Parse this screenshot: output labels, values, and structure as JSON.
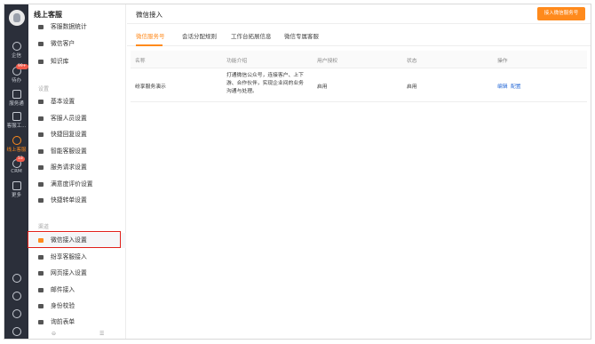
{
  "rail": {
    "items": [
      {
        "label": "企信",
        "icon": "chat-icon"
      },
      {
        "label": "待办",
        "icon": "todo-icon",
        "badge": "99+"
      },
      {
        "label": "服务通",
        "icon": "calendar-icon"
      },
      {
        "label": "客服工...",
        "icon": "box-icon"
      },
      {
        "label": "线上客服",
        "icon": "smile-icon"
      },
      {
        "label": "CRM",
        "icon": "clock-icon",
        "badge": "53"
      },
      {
        "label": "更多",
        "icon": "grid-icon"
      }
    ],
    "bottom_icons": [
      "help-icon",
      "settings-icon",
      "history-icon",
      "user-icon"
    ]
  },
  "sidebar": {
    "title": "线上客服",
    "top_items": [
      {
        "label": "客服数据统计"
      },
      {
        "label": "微信客户"
      },
      {
        "label": "知识库"
      }
    ],
    "settings_group": "设置",
    "settings_items": [
      {
        "label": "基本设置"
      },
      {
        "label": "客服人员设置"
      },
      {
        "label": "快捷回复设置"
      },
      {
        "label": "智能客服设置"
      },
      {
        "label": "服务请求设置"
      },
      {
        "label": "满意度评价设置"
      },
      {
        "label": "快捷转单设置"
      }
    ],
    "access_group": "渠道",
    "access_items": [
      {
        "label": "微信接入设置"
      },
      {
        "label": "纷享客服接入"
      },
      {
        "label": "网页接入设置"
      },
      {
        "label": "邮件接入"
      },
      {
        "label": "身份校验"
      },
      {
        "label": "询前表单"
      }
    ]
  },
  "main": {
    "title": "微信接入",
    "primary_button": "接入微信服务号",
    "tabs": [
      {
        "label": "微信服务号"
      },
      {
        "label": "会话分配规则"
      },
      {
        "label": "工作台拓展信息"
      },
      {
        "label": "微信专属客服"
      }
    ],
    "table": {
      "headers": [
        "名称",
        "功能介绍",
        "用户授权",
        "状态",
        "操作"
      ],
      "rows": [
        {
          "name": "纷享服务演示",
          "desc": "打通微信公众号，连接客户、上下游、合作伙伴，实现企业间的业务沟通与处理。",
          "auth": "启用",
          "status": "启用",
          "action_edit": "编辑",
          "action_config": "配置"
        }
      ]
    }
  },
  "colors": {
    "accent": "#ff8a1c",
    "rail": "#2b2f3a",
    "link": "#2f6fd8",
    "highlight": "#e0201a"
  }
}
